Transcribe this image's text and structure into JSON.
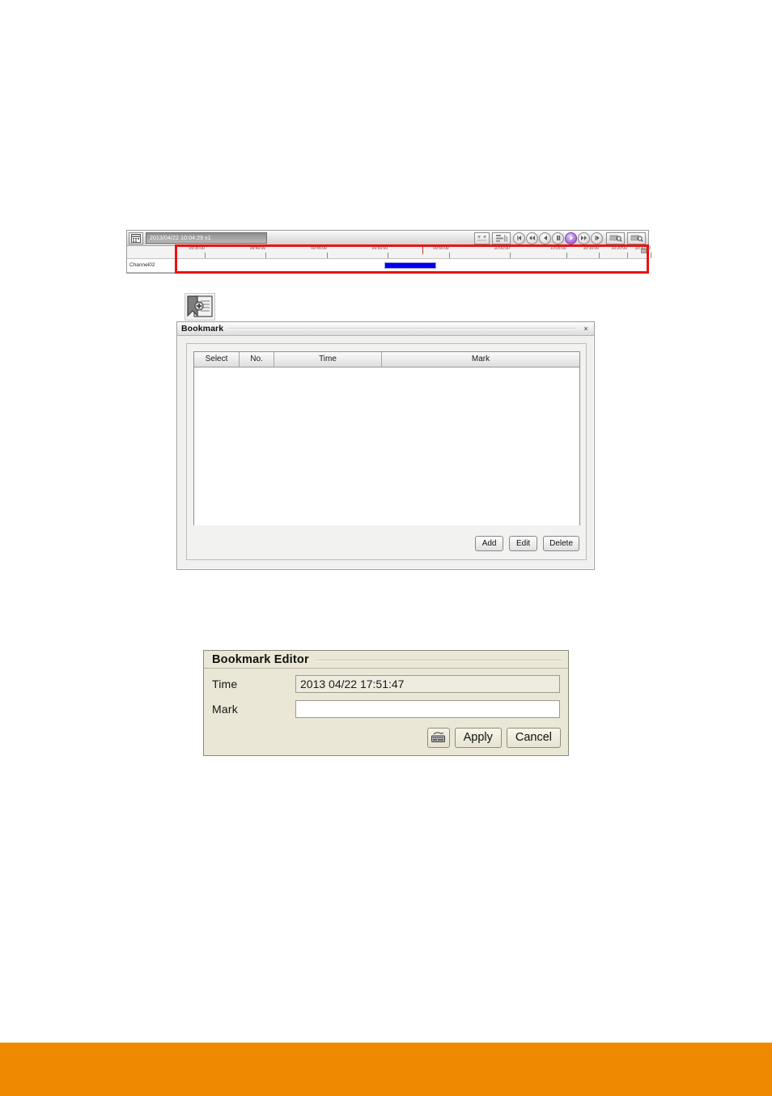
{
  "page": {
    "footer_color": "#EF8A00",
    "highlight_color": "#EE1111",
    "recording_bar_color": "#0000F0",
    "active_button_color": "#8F4DC2"
  },
  "timeline": {
    "calendar_icon": "calendar-icon",
    "datetime_value": "2013/04/22 10:04:29 x1",
    "speed": "x1",
    "channel_label": "Channel02",
    "ruler_ticks": [
      {
        "label": "09:35:00",
        "pct": 4
      },
      {
        "label": "09:40:00",
        "pct": 17
      },
      {
        "label": "09:45:00",
        "pct": 30
      },
      {
        "label": "09:50:00",
        "pct": 43
      },
      {
        "label": "09:55:00",
        "pct": 56
      },
      {
        "label": "10:00:00",
        "pct": 69
      },
      {
        "label": "10:05:00",
        "pct": 81
      },
      {
        "label": "10:10:00",
        "pct": 88
      },
      {
        "label": "10:20:00",
        "pct": 94
      },
      {
        "label": "10:30:00",
        "pct": 99
      }
    ],
    "recording_segment": {
      "start_pct": 44,
      "end_pct": 55
    },
    "playhead_pct": 52,
    "toolbar_buttons": [
      {
        "name": "select-range-icon",
        "label": ""
      },
      {
        "name": "segment-list-icon",
        "label": ""
      }
    ],
    "playback_buttons": [
      {
        "name": "step-first-icon",
        "label": "",
        "active": false
      },
      {
        "name": "rewind-icon",
        "label": "",
        "active": false
      },
      {
        "name": "step-backward-icon",
        "label": "",
        "active": false
      },
      {
        "name": "pause-icon",
        "label": "",
        "active": false
      },
      {
        "name": "play-icon",
        "label": "",
        "active": true
      },
      {
        "name": "fast-forward-icon",
        "label": "",
        "active": false
      },
      {
        "name": "step-forward-icon",
        "label": "",
        "active": false
      }
    ],
    "search_buttons": [
      {
        "name": "search-zoom-in-icon",
        "label": ""
      },
      {
        "name": "search-zoom-out-icon",
        "label": ""
      }
    ]
  },
  "bookmark_icon_button": {
    "name": "add-bookmark-icon",
    "tooltip": "Bookmark"
  },
  "bookmark_dialog": {
    "title": "Bookmark",
    "close_label": "×",
    "columns": [
      "Select",
      "No.",
      "Time",
      "Mark"
    ],
    "rows": [],
    "buttons": {
      "add": "Add",
      "edit": "Edit",
      "delete": "Delete"
    }
  },
  "bookmark_editor": {
    "title": "Bookmark Editor",
    "fields": {
      "time_label": "Time",
      "time_value": "2013 04/22  17:51:47",
      "mark_label": "Mark",
      "mark_value": "",
      "mark_placeholder": ""
    },
    "keyboard_icon": "virtual-keyboard-icon",
    "buttons": {
      "apply": "Apply",
      "cancel": "Cancel"
    }
  }
}
